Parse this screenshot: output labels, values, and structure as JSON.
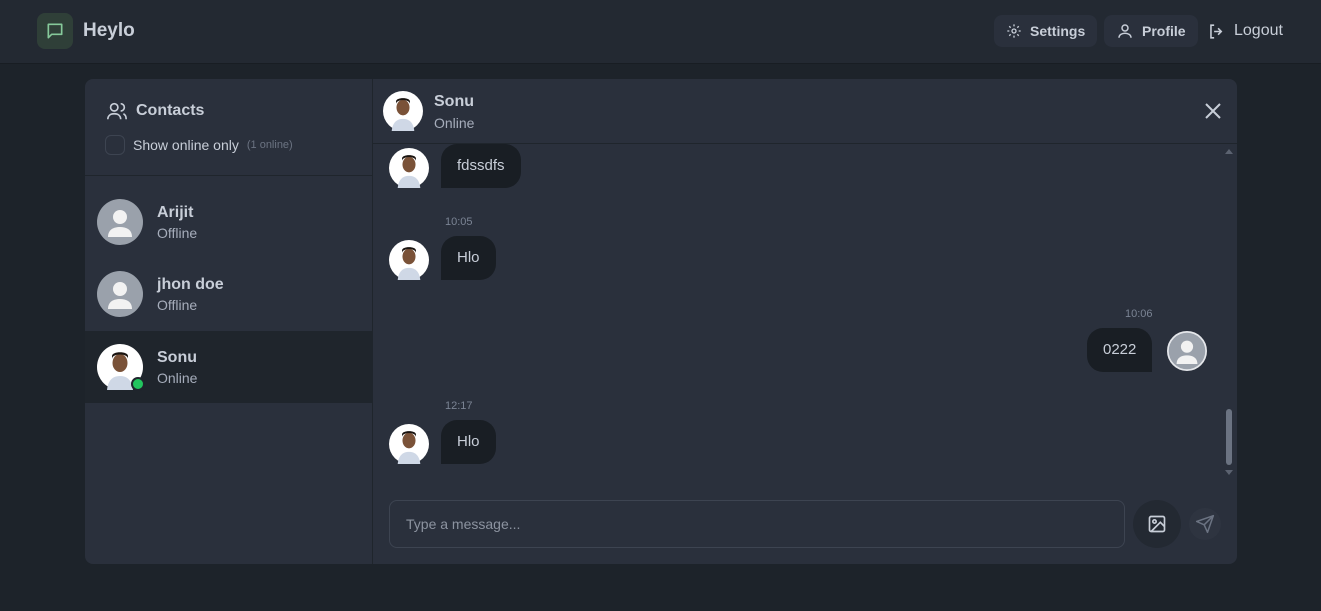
{
  "app": {
    "name": "Heylo"
  },
  "nav": {
    "settings": "Settings",
    "profile": "Profile",
    "logout": "Logout"
  },
  "sidebar": {
    "title": "Contacts",
    "filter_label": "Show online only",
    "online_count": "(1 online)",
    "contacts": [
      {
        "name": "Arijit",
        "status": "Offline",
        "avatar": "default-avatar"
      },
      {
        "name": "jhon doe",
        "status": "Offline",
        "avatar": "default-avatar"
      },
      {
        "name": "Sonu",
        "status": "Online",
        "avatar": "photo-avatar"
      }
    ]
  },
  "chat": {
    "name": "Sonu",
    "status": "Online",
    "messages": [
      {
        "from": "contact",
        "time": "",
        "text": "fdssdfs"
      },
      {
        "from": "contact",
        "time": "10:05",
        "text": "Hlo"
      },
      {
        "from": "me",
        "time": "10:06",
        "text": "0222"
      },
      {
        "from": "contact",
        "time": "12:17",
        "text": "Hlo"
      }
    ],
    "input_placeholder": "Type a message..."
  },
  "colors": {
    "accent": "#22c55e",
    "bubble": "#191e24",
    "panel": "#2a303c"
  }
}
